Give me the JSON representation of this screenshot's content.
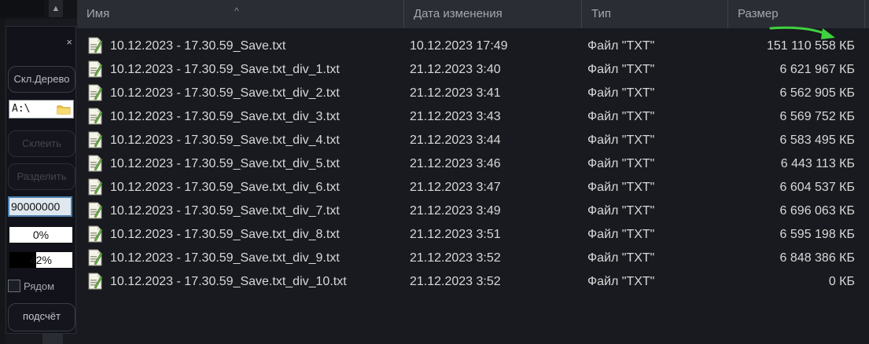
{
  "explorer": {
    "columns": {
      "name": "Имя",
      "date": "Дата изменения",
      "type": "Тип",
      "size": "Размер"
    },
    "sort_indicator": "^",
    "files": [
      {
        "name": "10.12.2023 - 17.30.59_Save.txt",
        "date": "10.12.2023 17:49",
        "type": "Файл \"TXT\"",
        "size": "151 110 558 КБ"
      },
      {
        "name": "10.12.2023 - 17.30.59_Save.txt_div_1.txt",
        "date": "21.12.2023 3:40",
        "type": "Файл \"TXT\"",
        "size": "6 621 967 КБ"
      },
      {
        "name": "10.12.2023 - 17.30.59_Save.txt_div_2.txt",
        "date": "21.12.2023 3:41",
        "type": "Файл \"TXT\"",
        "size": "6 562 905 КБ"
      },
      {
        "name": "10.12.2023 - 17.30.59_Save.txt_div_3.txt",
        "date": "21.12.2023 3:43",
        "type": "Файл \"TXT\"",
        "size": "6 569 752 КБ"
      },
      {
        "name": "10.12.2023 - 17.30.59_Save.txt_div_4.txt",
        "date": "21.12.2023 3:44",
        "type": "Файл \"TXT\"",
        "size": "6 583 495 КБ"
      },
      {
        "name": "10.12.2023 - 17.30.59_Save.txt_div_5.txt",
        "date": "21.12.2023 3:46",
        "type": "Файл \"TXT\"",
        "size": "6 443 113 КБ"
      },
      {
        "name": "10.12.2023 - 17.30.59_Save.txt_div_6.txt",
        "date": "21.12.2023 3:47",
        "type": "Файл \"TXT\"",
        "size": "6 604 537 КБ"
      },
      {
        "name": "10.12.2023 - 17.30.59_Save.txt_div_7.txt",
        "date": "21.12.2023 3:49",
        "type": "Файл \"TXT\"",
        "size": "6 696 063 КБ"
      },
      {
        "name": "10.12.2023 - 17.30.59_Save.txt_div_8.txt",
        "date": "21.12.2023 3:51",
        "type": "Файл \"TXT\"",
        "size": "6 595 198 КБ"
      },
      {
        "name": "10.12.2023 - 17.30.59_Save.txt_div_9.txt",
        "date": "21.12.2023 3:52",
        "type": "Файл \"TXT\"",
        "size": "6 848 386 КБ"
      },
      {
        "name": "10.12.2023 - 17.30.59_Save.txt_div_10.txt",
        "date": "21.12.2023 3:52",
        "type": "Файл \"TXT\"",
        "size": "0 КБ"
      }
    ],
    "file_icon": "txt-file-icon",
    "annotation_arrow_color": "#3fd23f"
  },
  "panel": {
    "close_label": "×",
    "tree_button": "Скл.Дерево",
    "path_value": "A:\\",
    "glue_button": "Склеить",
    "split_button": "Разделить",
    "chunk_size_value": "90000000",
    "progress_1": {
      "label": "0%",
      "fraction": 0.0
    },
    "progress_2": {
      "label": "42%",
      "fraction": 0.42
    },
    "beside_checkbox_label": "Рядом",
    "beside_checked": false,
    "count_button": "подсчёт"
  },
  "colors": {
    "background": "#191a1f",
    "header_bg": "#2b2d34",
    "text": "#d8d8d8",
    "header_text": "#a3a7ae",
    "accent_blue": "#4c80b1"
  }
}
